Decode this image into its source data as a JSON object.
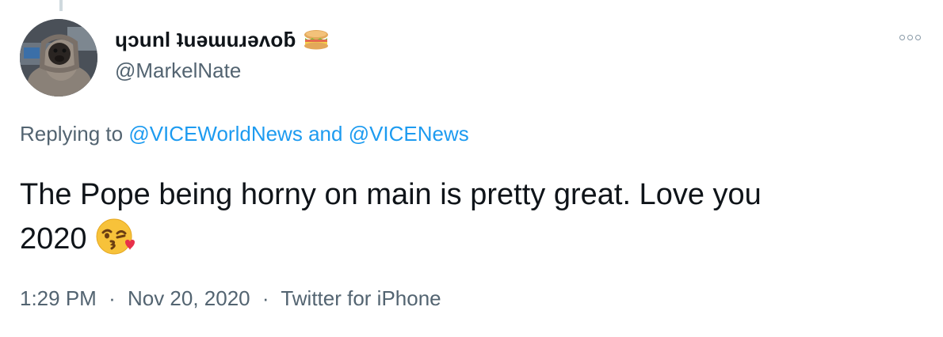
{
  "author": {
    "display_name": "ɥɔunl ʇuǝɯuɹǝʌoƃ",
    "handle": "@MarkelNate",
    "name_emoji": "sandwich-icon",
    "avatar": "pug-in-hood-avatar"
  },
  "reply": {
    "prefix": "Replying to",
    "mention_1": "@VICEWorldNews",
    "joiner": "and",
    "mention_2": "@VICENews"
  },
  "tweet": {
    "text_line_1": "The Pope being horny on main is pretty great.  Love you",
    "text_line_2": "2020",
    "emoji": "face-blowing-kiss-icon"
  },
  "meta": {
    "time": "1:29 PM",
    "date": "Nov 20, 2020",
    "source": "Twitter for iPhone",
    "separator": "·"
  },
  "colors": {
    "link": "#1d9bf0",
    "secondary_text": "#536471",
    "primary_text": "#0f1419"
  }
}
